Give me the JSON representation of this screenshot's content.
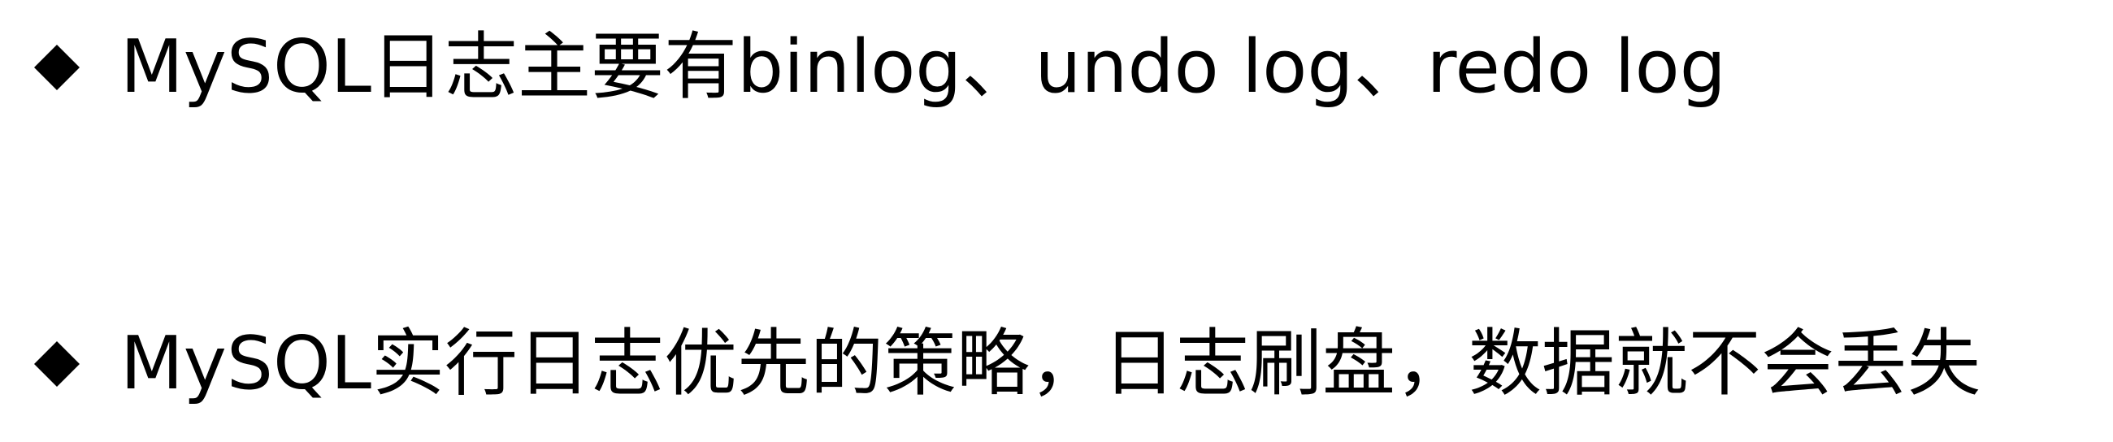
{
  "slide": {
    "bullets": [
      {
        "icon": "diamond-bullet-icon",
        "text": "MySQL日志主要有binlog、undo log、redo log"
      },
      {
        "icon": "diamond-bullet-icon",
        "text": "MySQL实行日志优先的策略，日志刷盘，数据就不会丢失"
      }
    ]
  }
}
